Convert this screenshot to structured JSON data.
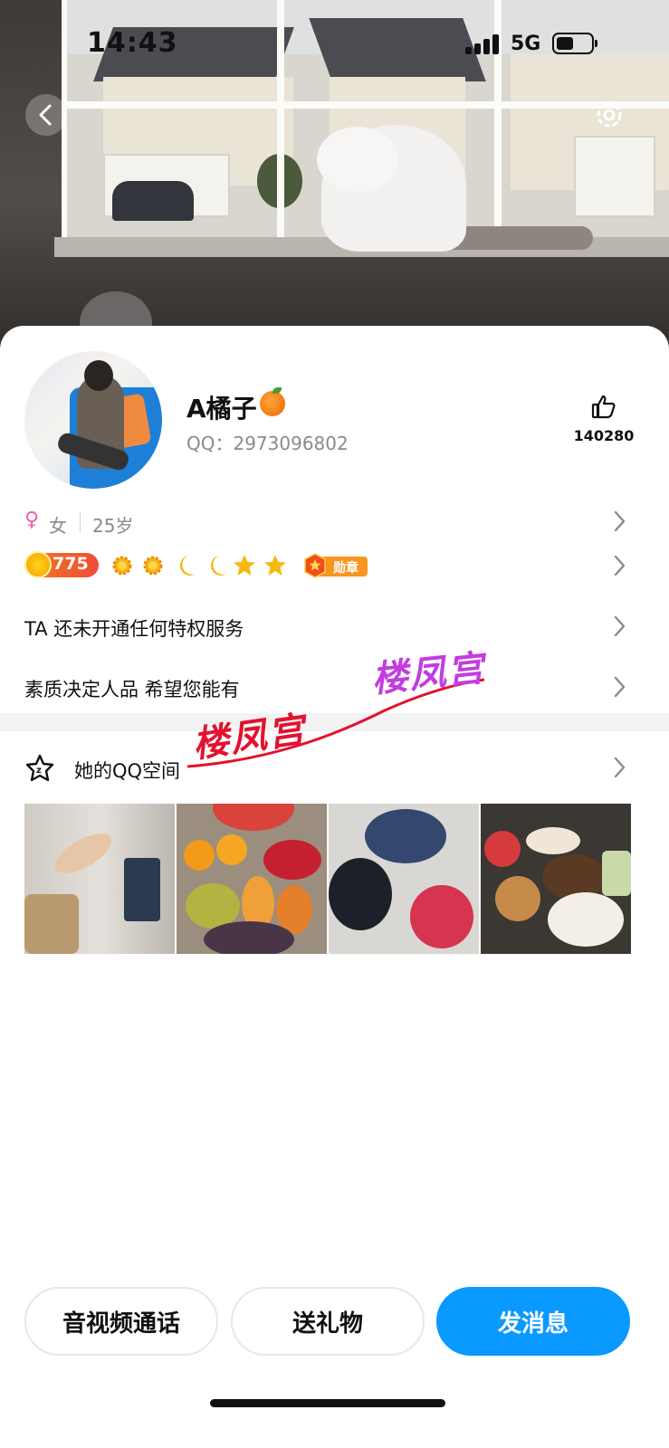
{
  "status_bar": {
    "time": "14:43",
    "network": "5G"
  },
  "header": {
    "back_icon": "chevron-left-icon",
    "settings_icon": "gear-icon"
  },
  "profile": {
    "nickname": "A橘子",
    "nickname_emoji": "orange-emoji-icon",
    "qq_label": "QQ：2973096802",
    "likes": "140280",
    "gender": "女",
    "gender_icon": "female-icon",
    "age": "25岁",
    "level": "775",
    "level_icons": [
      "sun-icon",
      "sun-icon",
      "moon-icon",
      "moon-icon",
      "star-icon",
      "star-icon"
    ],
    "medal_label": "勋章",
    "privilege_text": "TA 还未开通任何特权服务",
    "signature": "素质决定人品 希望您能有"
  },
  "watermarks": [
    "楼凤宫",
    "楼凤宫"
  ],
  "qzone": {
    "title": "她的QQ空间",
    "photos": [
      "hand-and-tv-photo",
      "fruit-platter-photo",
      "berries-photo",
      "dinner-table-photo"
    ]
  },
  "actions": {
    "call_label": "音视频通话",
    "gift_label": "送礼物",
    "message_label": "发消息"
  },
  "colors": {
    "accent": "#0a99ff",
    "female": "#f25fa2",
    "level": "#f14b3a",
    "watermark_red": "#e3122e",
    "watermark_purple": "#c33ce0"
  }
}
